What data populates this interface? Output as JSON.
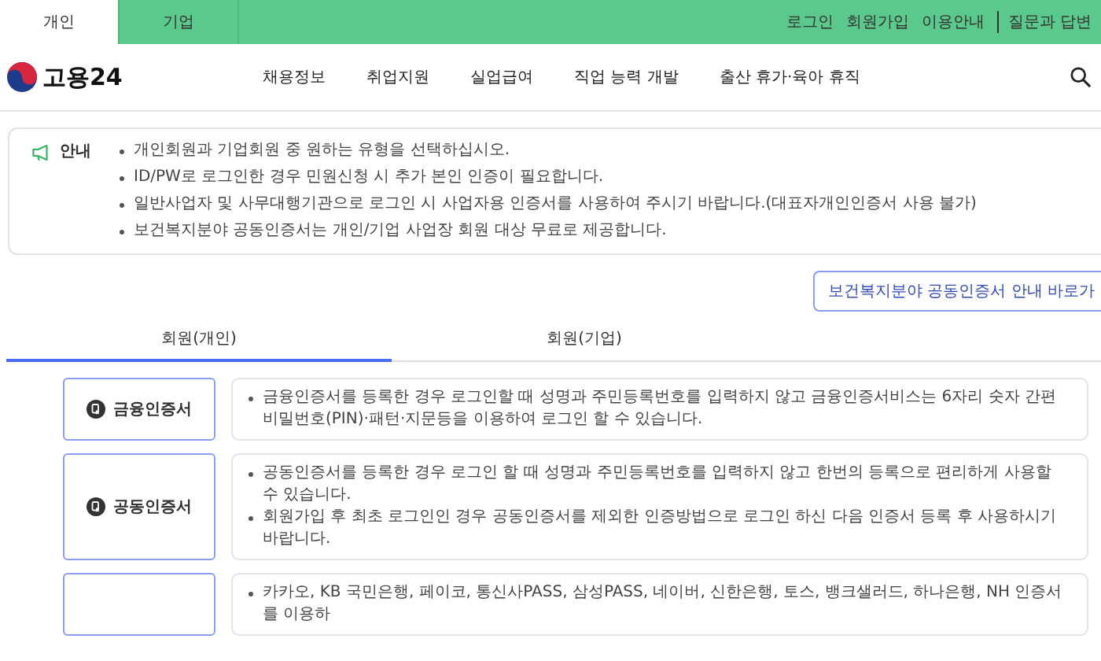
{
  "top_bar": {
    "audience_tabs": [
      {
        "label": "개인",
        "selected": true
      },
      {
        "label": "기업",
        "selected": false
      }
    ],
    "utility_links": [
      "로그인",
      "회원가입",
      "이용안내",
      "질문과 답변"
    ]
  },
  "header": {
    "logo": "고용24",
    "nav": [
      "채용정보",
      "취업지원",
      "실업급여",
      "직업 능력 개발",
      "출산 휴가·육아 휴직"
    ]
  },
  "notice": {
    "label": "안내",
    "items": [
      "개인회원과 기업회원 중 원하는 유형을 선택하십시오.",
      "ID/PW로 로그인한 경우 민원신청 시 추가 본인 인증이 필요합니다.",
      "일반사업자 및 사무대행기관으로 로그인 시 사업자용 인증서를 사용하여 주시기 바랍니다.(대표자개인인증서 사용 불가)",
      "보건복지분야 공동인증서는 개인/기업 사업장 회원 대상 무료로 제공합니다."
    ]
  },
  "guide_button": "보건복지분야 공동인증서 안내 바로가",
  "member_tabs": [
    {
      "label": "회원(개인)",
      "selected": true
    },
    {
      "label": "회원(기업)",
      "selected": false
    }
  ],
  "auth_methods": [
    {
      "label": "금융인증서",
      "lines": [
        "금융인증서를 등록한 경우 로그인할 때 성명과 주민등록번호를 입력하지 않고 금융인증서비스는 6자리 숫자 간편비밀번호(PIN)·패턴·지문등을 이용하여 로그인 할 수 있습니다."
      ]
    },
    {
      "label": "공동인증서",
      "lines": [
        "공동인증서를 등록한 경우 로그인 할 때 성명과 주민등록번호를 입력하지 않고 한번의 등록으로 편리하게 사용할 수 있습니다.",
        "회원가입 후 최초 로그인인 경우 공동인증서를 제외한 인증방법으로 로그인 하신 다음 인증서 등록 후 사용하시기바랍니다."
      ]
    },
    {
      "lines": [
        "카카오, KB 국민은행, 페이코, 통신사PASS, 삼성PASS, 네이버, 신한은행, 토스, 뱅크샐러드, 하나은행, NH 인증서를 이용하"
      ]
    }
  ]
}
